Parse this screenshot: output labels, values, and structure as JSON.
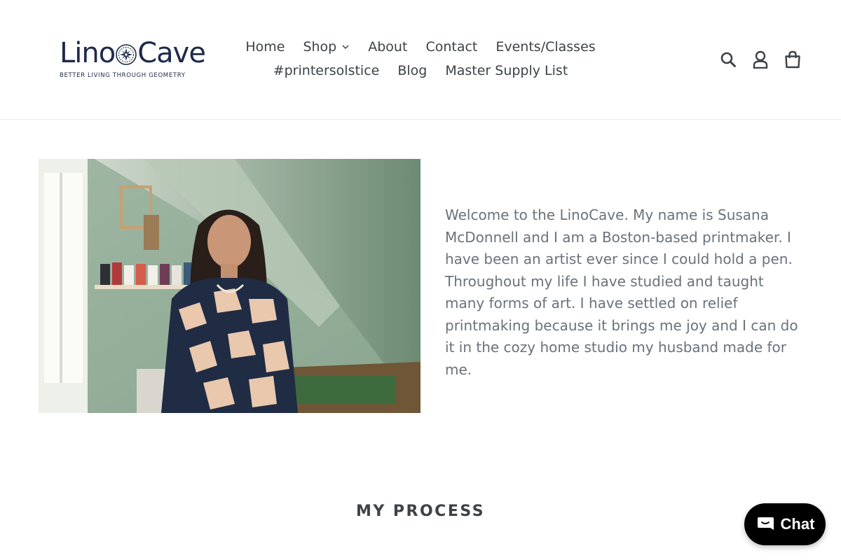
{
  "brand": {
    "name_part1": "Lino",
    "name_part2": "Cave",
    "tagline": "BETTER LIVING THROUGH GEOMETRY",
    "color": "#1e2a4a"
  },
  "nav": {
    "row1": [
      {
        "label": "Home"
      },
      {
        "label": "Shop",
        "has_dropdown": true
      },
      {
        "label": "About"
      },
      {
        "label": "Contact"
      },
      {
        "label": "Events/Classes"
      }
    ],
    "row2": [
      {
        "label": "#printersolstice"
      },
      {
        "label": "Blog"
      },
      {
        "label": "Master Supply List"
      }
    ]
  },
  "header_icons": [
    "search-icon",
    "account-icon",
    "cart-icon"
  ],
  "intro": {
    "image": "portrait-in-home-studio",
    "text": "Welcome to the LinoCave. My name is Susana McDonnell and I am a Boston-based printmaker. I have been an artist ever since I could hold a pen. Throughout my life I have studied and taught many forms of art. I have settled on relief printmaking because it brings me joy and I can do it in the cozy home studio my husband made for me."
  },
  "process": {
    "heading": "MY PROCESS"
  },
  "chat": {
    "label": "Chat",
    "icon": "chat-bubble-icon",
    "background": "#000000"
  },
  "colors": {
    "text": "#3d4246",
    "body_text": "#69727b",
    "divider": "#e8e9eb"
  }
}
